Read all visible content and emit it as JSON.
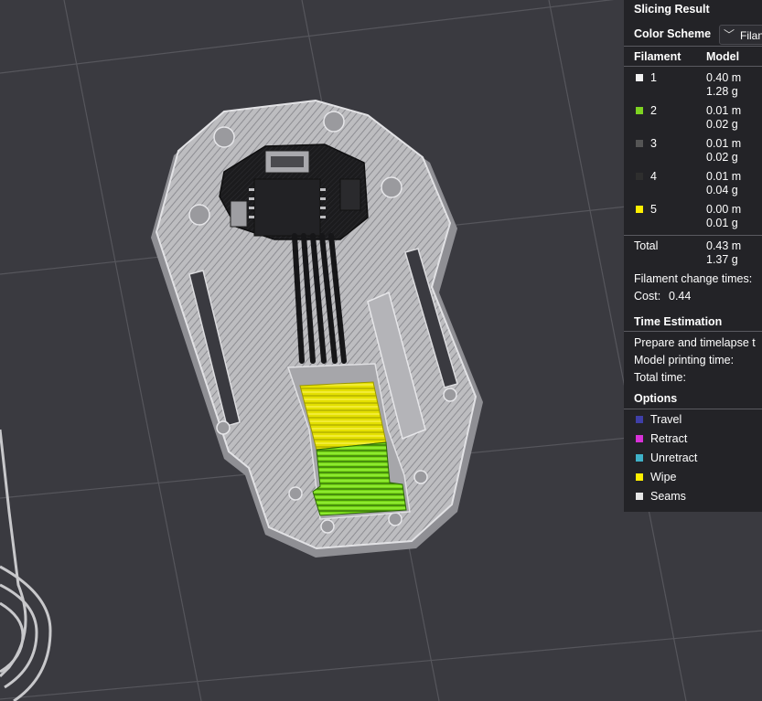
{
  "panel": {
    "title": "Slicing Result",
    "color_scheme_label": "Color Scheme",
    "color_scheme_value": "Filan",
    "table_headers": {
      "filament": "Filament",
      "model": "Model"
    },
    "filaments": [
      {
        "id": "1",
        "length": "0.40 m",
        "weight": "1.28 g",
        "color": "#f2f2f2"
      },
      {
        "id": "2",
        "length": "0.01 m",
        "weight": "0.02 g",
        "color": "#7ed321"
      },
      {
        "id": "3",
        "length": "0.01 m",
        "weight": "0.02 g",
        "color": "#555555"
      },
      {
        "id": "4",
        "length": "0.01 m",
        "weight": "0.04 g",
        "color": "#2e2e2e"
      },
      {
        "id": "5",
        "length": "0.00 m",
        "weight": "0.01 g",
        "color": "#ffef00"
      }
    ],
    "total": {
      "label": "Total",
      "length": "0.43 m",
      "weight": "1.37 g"
    },
    "filament_change_label": "Filament change times:",
    "cost_label": "Cost:",
    "cost_value": "0.44",
    "time_header": "Time Estimation",
    "time_items": [
      "Prepare and timelapse t",
      "Model printing time:",
      "Total time:"
    ],
    "options_header": "Options",
    "options": [
      {
        "label": "Travel",
        "color": "#3f3fa8"
      },
      {
        "label": "Retract",
        "color": "#d831d8"
      },
      {
        "label": "Unretract",
        "color": "#3fb1c8"
      },
      {
        "label": "Wipe",
        "color": "#ffef00"
      },
      {
        "label": "Seams",
        "color": "#e6e6e6"
      }
    ]
  }
}
